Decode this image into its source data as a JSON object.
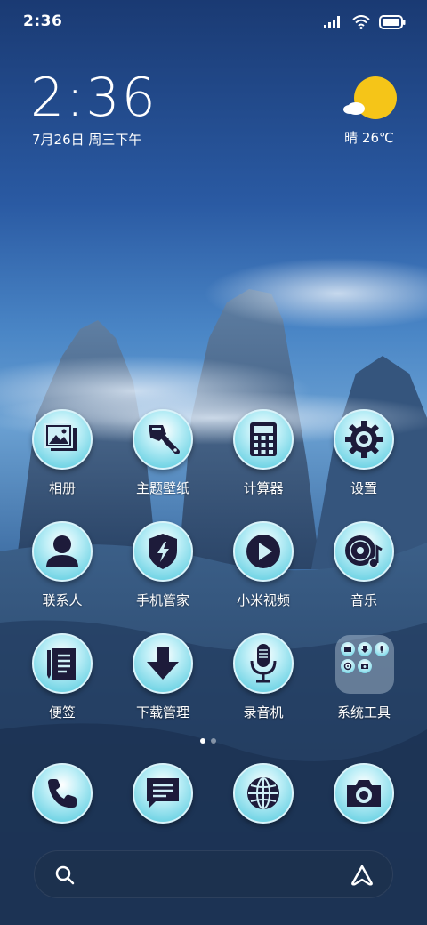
{
  "status_bar": {
    "time": "2:36",
    "icons": [
      "signal-icon",
      "wifi-icon",
      "battery-icon"
    ]
  },
  "clock_widget": {
    "time": "2:36",
    "date": "7月26日 周三下午"
  },
  "weather_widget": {
    "icon": "sunny-cloud-icon",
    "text": "晴 26℃",
    "sun_color": "#f5c518"
  },
  "apps": [
    {
      "label": "相册",
      "icon": "gallery-icon"
    },
    {
      "label": "主题壁纸",
      "icon": "theme-brush-icon"
    },
    {
      "label": "计算器",
      "icon": "calculator-icon"
    },
    {
      "label": "设置",
      "icon": "gear-icon"
    },
    {
      "label": "联系人",
      "icon": "contact-person-icon"
    },
    {
      "label": "手机管家",
      "icon": "security-shield-icon"
    },
    {
      "label": "小米视频",
      "icon": "play-icon"
    },
    {
      "label": "音乐",
      "icon": "music-disc-icon"
    },
    {
      "label": "便签",
      "icon": "notes-icon"
    },
    {
      "label": "下载管理",
      "icon": "download-arrow-icon"
    },
    {
      "label": "录音机",
      "icon": "microphone-icon"
    },
    {
      "label": "系统工具",
      "icon": "folder-icon"
    }
  ],
  "dock": [
    {
      "icon": "phone-icon"
    },
    {
      "icon": "message-icon"
    },
    {
      "icon": "browser-globe-icon"
    },
    {
      "icon": "camera-icon"
    }
  ],
  "page_indicator": {
    "pages": 2,
    "current": 1
  },
  "search_bar": {
    "left_icon": "search-icon",
    "right_icon": "assistant-icon"
  },
  "colors": {
    "icon_bg_light": "#ffffff",
    "icon_bg_accent": "#4cc7dc",
    "glyph": "#1d1b3a"
  }
}
